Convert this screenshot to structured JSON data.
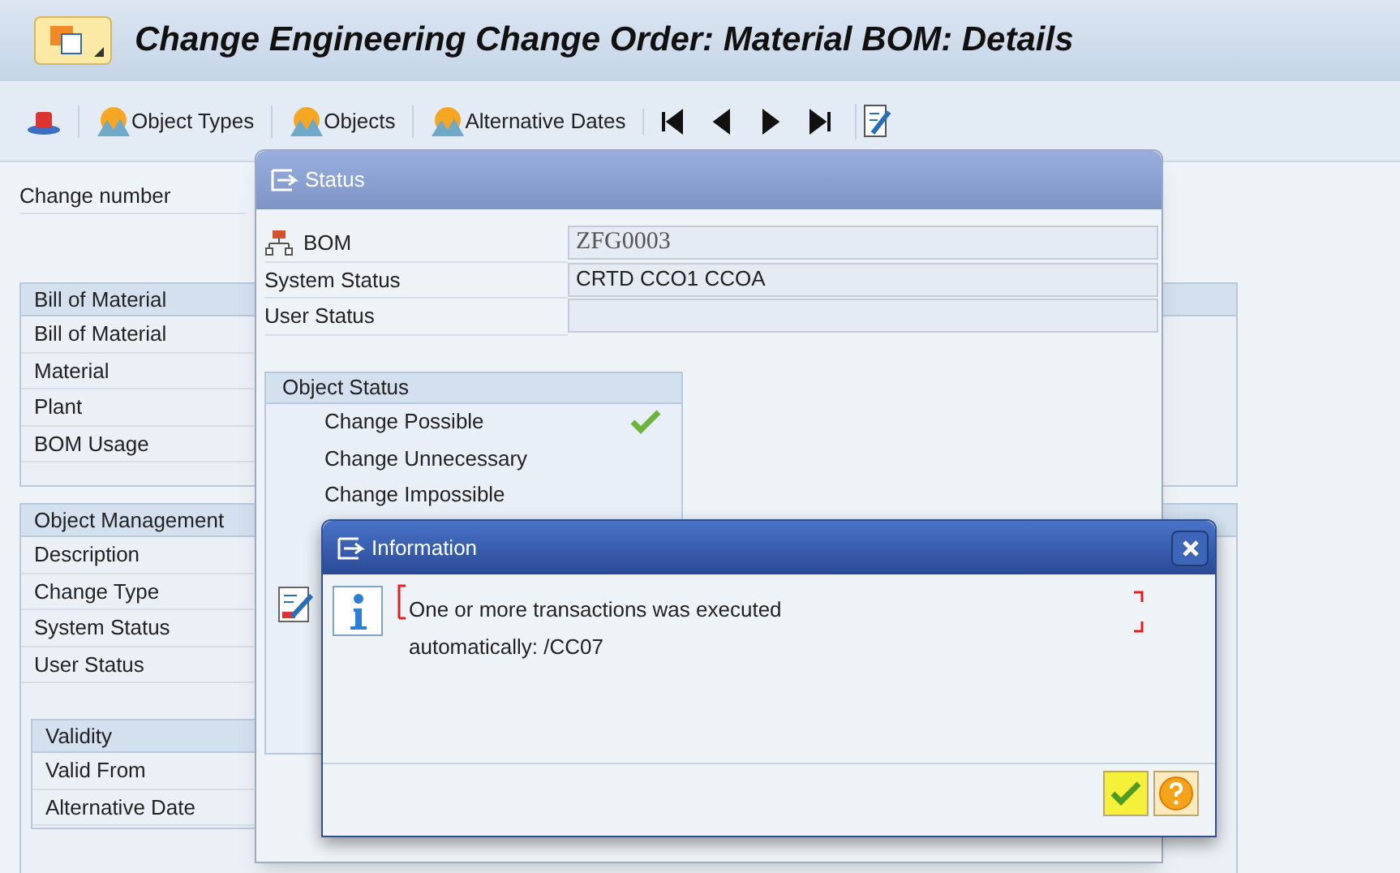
{
  "window": {
    "title": "Change Engineering Change Order: Material BOM: Details"
  },
  "toolbar": {
    "buttons": [
      {
        "label": "Object Types"
      },
      {
        "label": "Objects"
      },
      {
        "label": "Alternative Dates"
      }
    ]
  },
  "form": {
    "change_number_label": "Change number",
    "bill_of_material": {
      "title": "Bill of Material",
      "fields": [
        "Bill of Material",
        "Material",
        "Plant",
        "BOM Usage"
      ]
    },
    "object_management": {
      "title": "Object Management",
      "fields": [
        "Description",
        "Change Type",
        "System Status",
        "User Status"
      ],
      "validity": {
        "title": "Validity",
        "fields": [
          "Valid From",
          "Alternative Date"
        ]
      }
    }
  },
  "status_dialog": {
    "title": "Status",
    "rows": [
      {
        "kind": "object",
        "label": "BOM",
        "value": "ZFG0003"
      },
      {
        "kind": "text",
        "label": "System Status",
        "value": "CRTD CCO1 CCOA"
      },
      {
        "kind": "text",
        "label": "User Status",
        "value": ""
      }
    ],
    "object_status": {
      "title": "Object Status",
      "items": [
        {
          "label": "Change Possible",
          "checked": true
        },
        {
          "label": "Change Unnecessary",
          "checked": false
        },
        {
          "label": "Change Impossible",
          "checked": false
        }
      ]
    }
  },
  "info_dialog": {
    "title": "Information",
    "message_lines": [
      "One or more transactions was executed",
      "automatically: /CC07"
    ],
    "buttons": [
      {
        "kind": "confirm",
        "focused": true
      },
      {
        "kind": "help",
        "focused": false
      }
    ]
  }
}
